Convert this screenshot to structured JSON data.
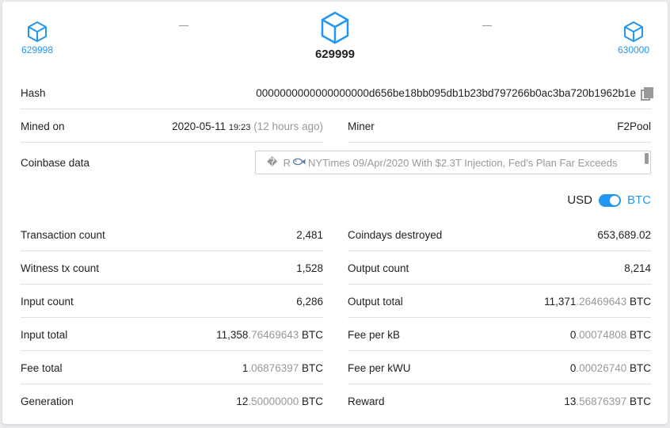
{
  "nav": {
    "prev_height": "629998",
    "current_height": "629999",
    "next_height": "630000",
    "separator": "–"
  },
  "hash": {
    "label": "Hash",
    "value": "0000000000000000000d656be18bb095db1b23bd797266b0ac3ba720b1962b1e"
  },
  "mined_on": {
    "label": "Mined on",
    "date": "2020-05-11",
    "time": "19:23",
    "ago": "(12 hours ago)"
  },
  "miner": {
    "label": "Miner",
    "value": "F2Pool"
  },
  "coinbase": {
    "label": "Coinbase data",
    "prefix": "�",
    "pre_fish": "R",
    "text": "NYTimes 09/Apr/2020 With $2.3T Injection, Fed's Plan Far Exceeds"
  },
  "currency_toggle": {
    "left": "USD",
    "right": "BTC",
    "selected": "BTC"
  },
  "left_stats": [
    {
      "label": "Transaction count",
      "main": "2,481",
      "dim": "",
      "unit": "",
      "link": true
    },
    {
      "label": "Witness tx count",
      "main": "1,528",
      "dim": "",
      "unit": "",
      "link": true
    },
    {
      "label": "Input count",
      "main": "6,286",
      "dim": "",
      "unit": "",
      "link": true
    },
    {
      "label": "Input total",
      "main": "11,358",
      "dim": ".76469643",
      "unit": "BTC",
      "link": false
    },
    {
      "label": "Fee total",
      "main": "1",
      "dim": ".06876397",
      "unit": "BTC",
      "link": false
    },
    {
      "label": "Generation",
      "main": "12",
      "dim": ".50000000",
      "unit": "BTC",
      "link": false
    }
  ],
  "right_stats": [
    {
      "label": "Coindays destroyed",
      "main": "653,689.02",
      "dim": "",
      "unit": "",
      "link": false
    },
    {
      "label": "Output count",
      "main": "8,214",
      "dim": "",
      "unit": "",
      "link": true
    },
    {
      "label": "Output total",
      "main": "11,371",
      "dim": ".26469643",
      "unit": "BTC",
      "link": false
    },
    {
      "label": "Fee per kB",
      "main": "0",
      "dim": ".00074808",
      "unit": "BTC",
      "link": false
    },
    {
      "label": "Fee per kWU",
      "main": "0",
      "dim": ".00026740",
      "unit": "BTC",
      "link": false
    },
    {
      "label": "Reward",
      "main": "13",
      "dim": ".56876397",
      "unit": "BTC",
      "link": false
    }
  ],
  "colors": {
    "accent": "#2196f3",
    "muted": "#999999",
    "divider": "#e2e2e2"
  }
}
